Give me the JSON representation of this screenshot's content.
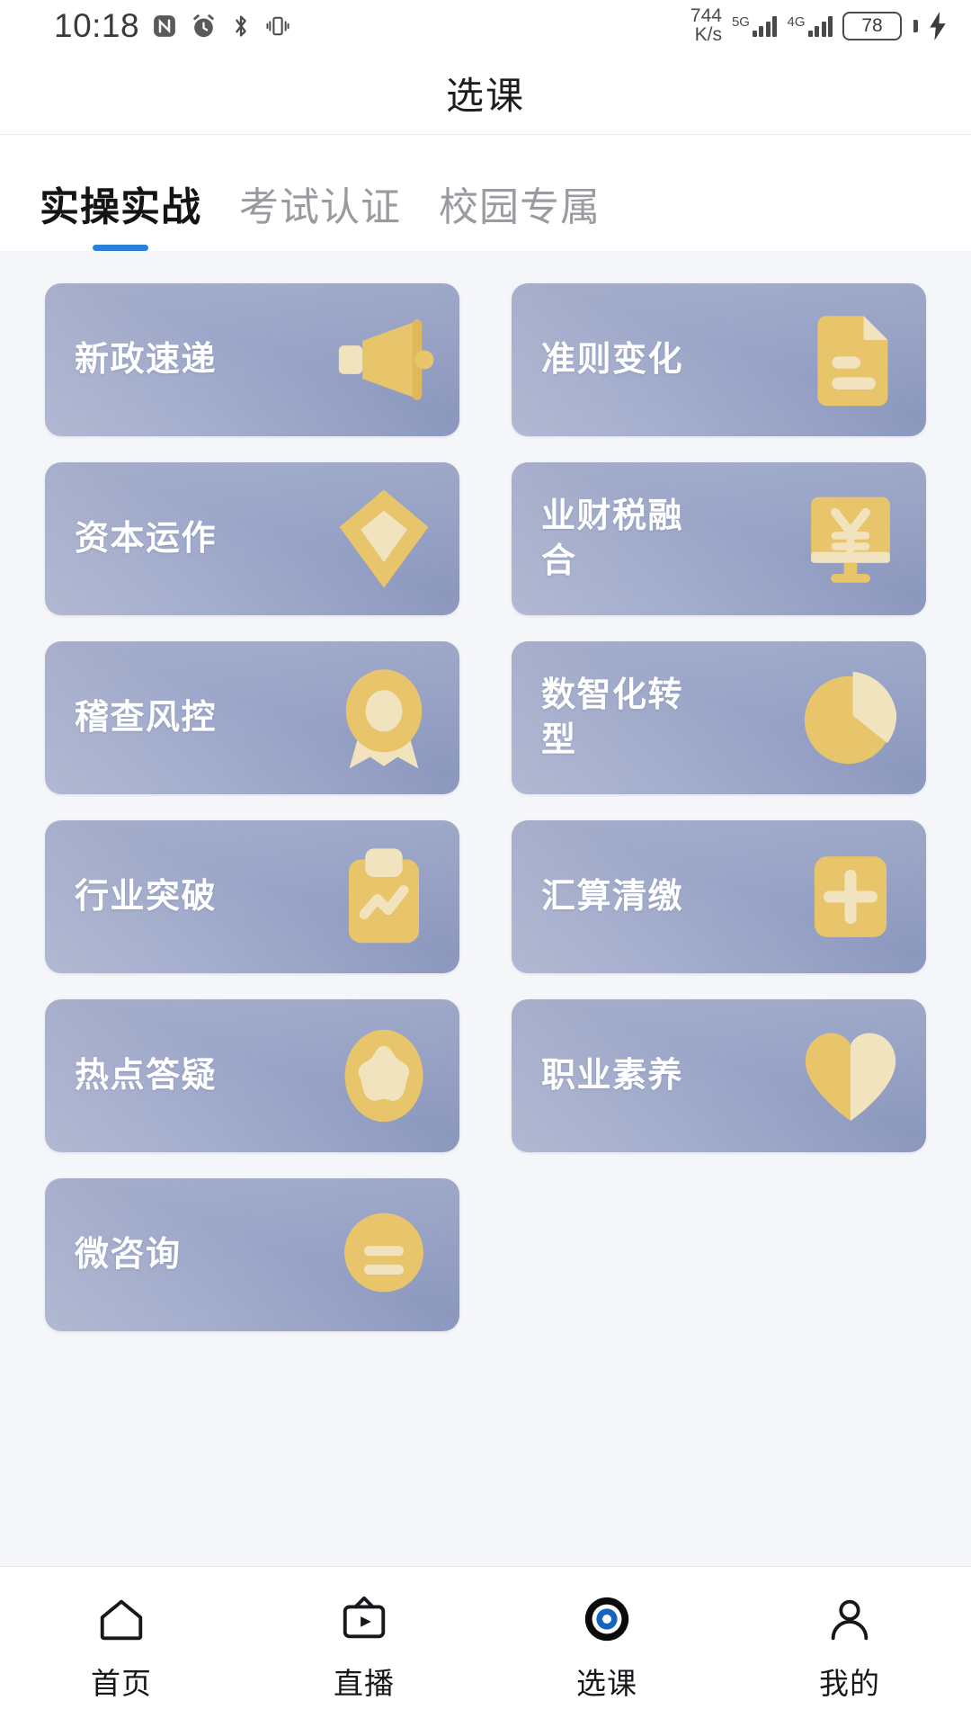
{
  "status_bar": {
    "time": "10:18",
    "icons": [
      "nfc-icon",
      "alarm-icon",
      "bluetooth-icon",
      "vibrate-icon"
    ],
    "net_speed_value": "744",
    "net_speed_unit": "K/s",
    "signal_1_label": "5G",
    "signal_2_label": "4G",
    "battery_level": "78",
    "charging_icon": "lightning-bolt-icon"
  },
  "header": {
    "title": "选课"
  },
  "tabs": {
    "active_index": 0,
    "items": [
      {
        "label": "实操实战"
      },
      {
        "label": "考试认证"
      },
      {
        "label": "校园专属"
      }
    ]
  },
  "colors": {
    "accent_blue": "#2b7fd4",
    "card_gradient_start": "#a7aecb",
    "card_gradient_end": "#8b97bd",
    "icon_gold": "#e8c46a",
    "icon_cream": "#f2e3bf",
    "page_background": "#f5f6f9",
    "tab_inactive": "#9a9aa0"
  },
  "course_grid": {
    "cards": [
      {
        "label": "新政速递",
        "icon": "megaphone-icon"
      },
      {
        "label": "准则变化",
        "icon": "document-icon"
      },
      {
        "label": "资本运作",
        "icon": "gem-icon"
      },
      {
        "label": "业财税融合",
        "icon": "monitor-yuan-icon"
      },
      {
        "label": "稽查风控",
        "icon": "medal-icon"
      },
      {
        "label": "数智化转型",
        "icon": "pie-chart-icon"
      },
      {
        "label": "行业突破",
        "icon": "clipboard-chart-icon"
      },
      {
        "label": "汇算清缴",
        "icon": "plus-card-icon"
      },
      {
        "label": "热点答疑",
        "icon": "star-circle-icon"
      },
      {
        "label": "职业素养",
        "icon": "heart-icon"
      },
      {
        "label": "微咨询",
        "icon": "document-lines-icon"
      }
    ]
  },
  "bottom_nav": {
    "active_index": 2,
    "items": [
      {
        "label": "首页",
        "icon": "home-icon"
      },
      {
        "label": "直播",
        "icon": "live-tv-icon"
      },
      {
        "label": "选课",
        "icon": "eye-target-icon"
      },
      {
        "label": "我的",
        "icon": "person-icon"
      }
    ]
  }
}
